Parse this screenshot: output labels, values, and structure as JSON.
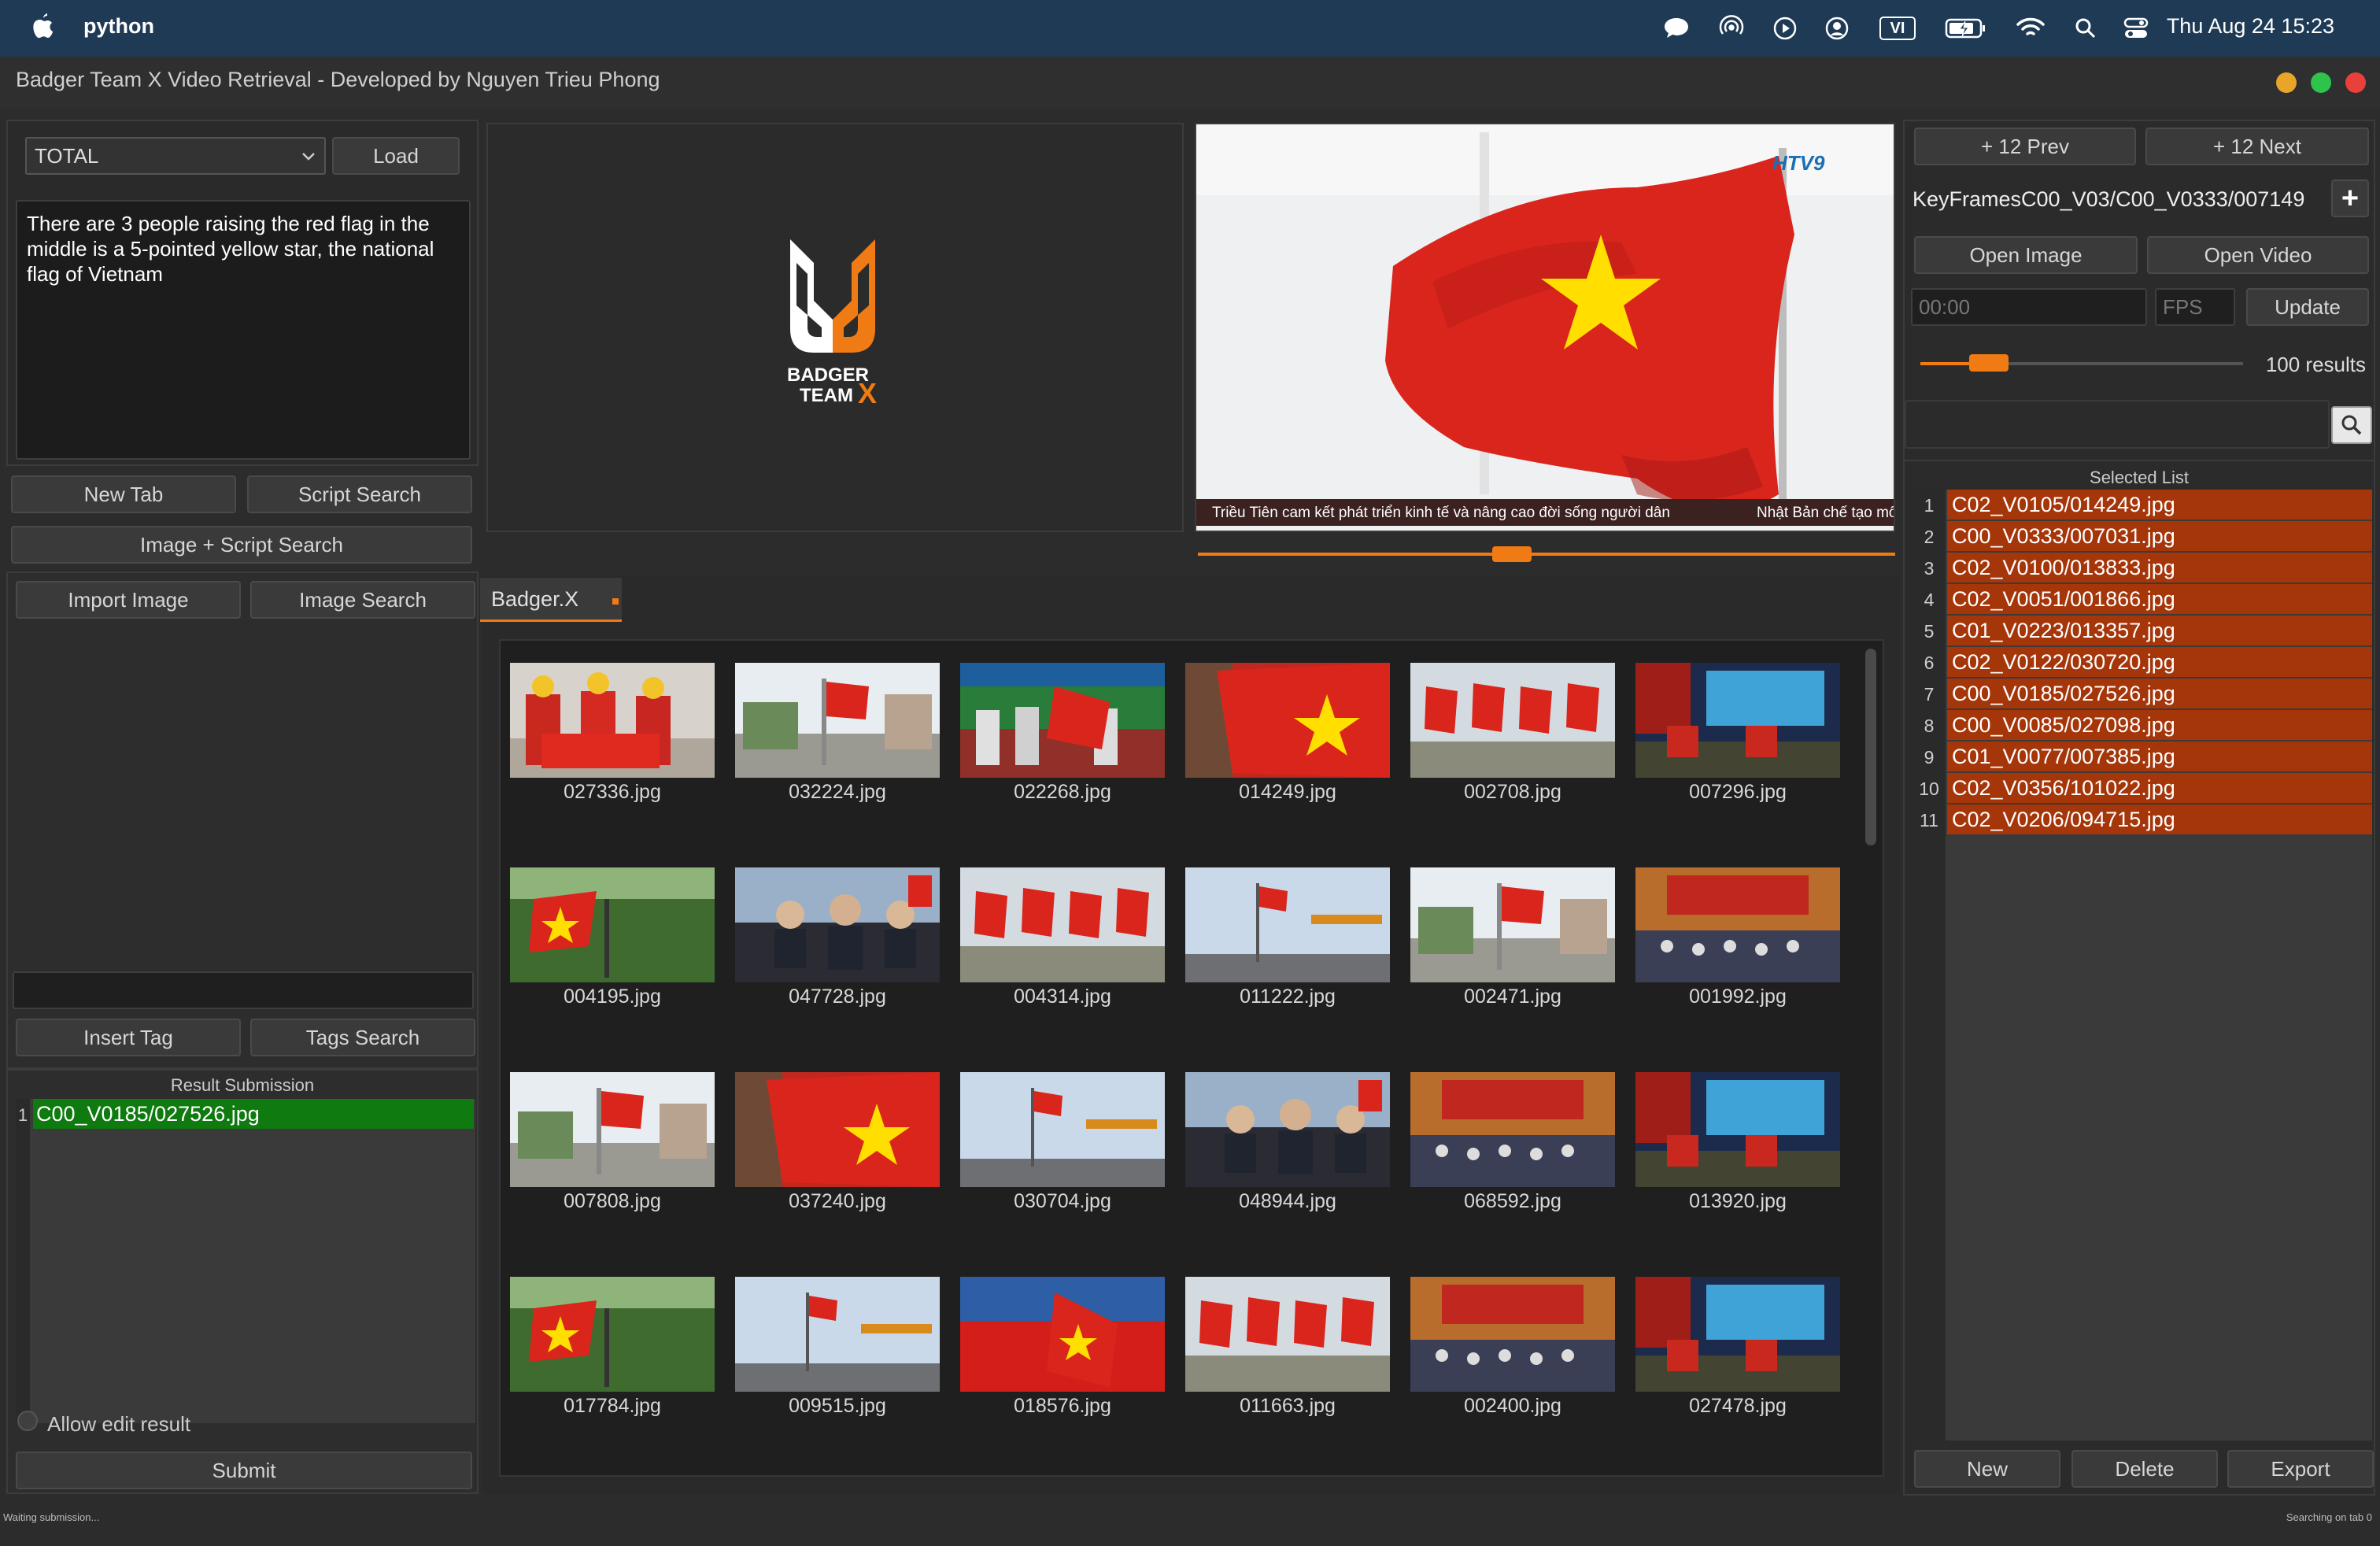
{
  "menubar": {
    "app_name": "python",
    "input_source": "VI",
    "clock": "Thu Aug 24  15:23",
    "icons": [
      "message-icon",
      "airdrop-icon",
      "play-icon",
      "user-icon",
      "input-source-icon",
      "battery-icon",
      "wifi-icon",
      "search-icon",
      "control-center-icon"
    ]
  },
  "window": {
    "title": "Badger Team X Video Retrieval - Developed by Nguyen Trieu Phong",
    "traffic_lights": [
      "#e9a42a",
      "#2ec34a",
      "#e8403a"
    ]
  },
  "left": {
    "dataset_select": "TOTAL",
    "load_label": "Load",
    "query_text": "There are 3 people raising the red flag in the middle is a 5-pointed yellow star, the national flag of Vietnam",
    "new_tab_label": "New Tab",
    "script_search_label": "Script Search",
    "image_script_search_label": "Image + Script Search",
    "import_image_label": "Import Image",
    "image_search_label": "Image Search",
    "insert_tag_label": "Insert Tag",
    "tags_search_label": "Tags Search",
    "result_submission_title": "Result Submission",
    "result_rows": [
      {
        "num": "1",
        "file": "C00_V0185/027526.jpg"
      }
    ],
    "allow_edit_label": "Allow edit result",
    "submit_label": "Submit"
  },
  "logo": {
    "line1": "BADGER",
    "line2": "TEAM",
    "accent": "X"
  },
  "player": {
    "channel_logo": "HTV9",
    "ticker_left": "Triều Tiên cam kết phát triển kinh tế và nâng cao đời sống người dân",
    "ticker_right": "Nhật Bản chế tạo mô",
    "progress": 0.45
  },
  "tabs": [
    {
      "label": "Badger.X",
      "modified_dot": true
    }
  ],
  "grid": [
    {
      "file": "027336.jpg",
      "scene": "people"
    },
    {
      "file": "032224.jpg",
      "scene": "street"
    },
    {
      "file": "022268.jpg",
      "scene": "ceremony"
    },
    {
      "file": "014249.jpg",
      "scene": "flag"
    },
    {
      "file": "002708.jpg",
      "scene": "flags"
    },
    {
      "file": "007296.jpg",
      "scene": "stage"
    },
    {
      "file": "004195.jpg",
      "scene": "trees"
    },
    {
      "file": "047728.jpg",
      "scene": "meeting"
    },
    {
      "file": "004314.jpg",
      "scene": "flags"
    },
    {
      "file": "011222.jpg",
      "scene": "sky"
    },
    {
      "file": "002471.jpg",
      "scene": "street"
    },
    {
      "file": "001992.jpg",
      "scene": "hall"
    },
    {
      "file": "007808.jpg",
      "scene": "street"
    },
    {
      "file": "037240.jpg",
      "scene": "flag"
    },
    {
      "file": "030704.jpg",
      "scene": "sky"
    },
    {
      "file": "048944.jpg",
      "scene": "meeting"
    },
    {
      "file": "068592.jpg",
      "scene": "hall"
    },
    {
      "file": "013920.jpg",
      "scene": "stage"
    },
    {
      "file": "017784.jpg",
      "scene": "trees"
    },
    {
      "file": "009515.jpg",
      "scene": "sky"
    },
    {
      "file": "018576.jpg",
      "scene": "red"
    },
    {
      "file": "011663.jpg",
      "scene": "flags"
    },
    {
      "file": "002400.jpg",
      "scene": "hall"
    },
    {
      "file": "027478.jpg",
      "scene": "stage"
    }
  ],
  "right": {
    "prev_label": "+ 12 Prev",
    "next_label": "+ 12 Next",
    "keyframe_path": "KeyFramesC00_V03/C00_V0333/007149",
    "add_symbol": "+",
    "open_image_label": "Open Image",
    "open_video_label": "Open Video",
    "time_placeholder": "00:00",
    "fps_placeholder": "FPS",
    "update_label": "Update",
    "results_label": "100 results",
    "results_slider": 0.15,
    "selected_title": "Selected List",
    "selected": [
      {
        "num": "1",
        "file": "C02_V0105/014249.jpg"
      },
      {
        "num": "2",
        "file": "C00_V0333/007031.jpg"
      },
      {
        "num": "3",
        "file": "C02_V0100/013833.jpg"
      },
      {
        "num": "4",
        "file": "C02_V0051/001866.jpg"
      },
      {
        "num": "5",
        "file": "C01_V0223/013357.jpg"
      },
      {
        "num": "6",
        "file": "C02_V0122/030720.jpg"
      },
      {
        "num": "7",
        "file": "C00_V0185/027526.jpg"
      },
      {
        "num": "8",
        "file": "C00_V0085/027098.jpg"
      },
      {
        "num": "9",
        "file": "C01_V0077/007385.jpg"
      },
      {
        "num": "10",
        "file": "C02_V0356/101022.jpg"
      },
      {
        "num": "11",
        "file": "C02_V0206/094715.jpg"
      }
    ],
    "new_label": "New",
    "delete_label": "Delete",
    "export_label": "Export"
  },
  "status": {
    "left": "Waiting submission...",
    "right": "Searching on tab 0"
  },
  "colors": {
    "accent_orange": "#f07a14",
    "selected_row": "#a5360a",
    "submission_row": "#0f7a0f",
    "flag_red": "#da251d",
    "flag_star": "#ffde00"
  }
}
